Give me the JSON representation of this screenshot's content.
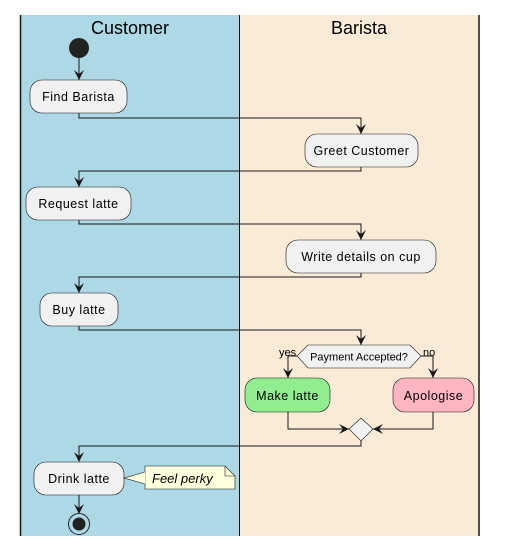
{
  "lanes": [
    {
      "title": "Customer",
      "color": "#ADD8E6"
    },
    {
      "title": "Barista",
      "color": "#FAEBD7"
    }
  ],
  "activities": {
    "find_barista": "Find Barista",
    "greet_customer": "Greet Customer",
    "request_latte": "Request latte",
    "write_details": "Write details on cup",
    "buy_latte": "Buy latte",
    "make_latte": "Make latte",
    "apologise": "Apologise",
    "drink_latte": "Drink latte"
  },
  "decision": {
    "question": "Payment Accepted?",
    "yes_label": "yes",
    "no_label": "no"
  },
  "note": {
    "text": "Feel perky"
  },
  "colors": {
    "make_latte": "#90EE90",
    "apologise": "#FFB6C1",
    "note": "#FEFFDD",
    "node": "#F1F1F1"
  }
}
